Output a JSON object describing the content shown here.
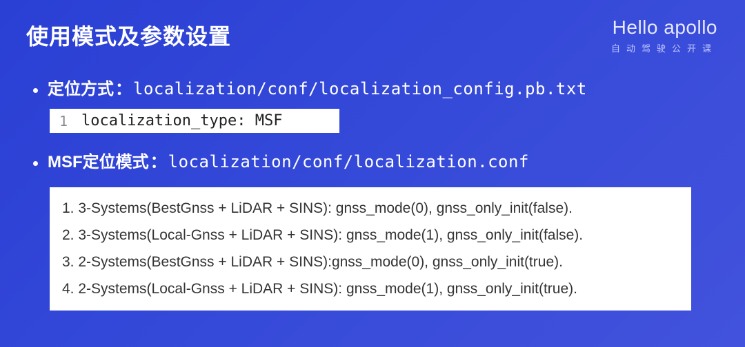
{
  "header": {
    "title": "使用模式及参数设置",
    "brand_main": "Hello apollo",
    "brand_sub": "自动驾驶公开课"
  },
  "section1": {
    "label": "定位方式",
    "colon": "：",
    "path": "localization/conf/localization_config.pb.txt",
    "code_lineno": "1",
    "code_text": "localization_type: MSF"
  },
  "section2": {
    "label": "MSF定位模式",
    "colon": "：",
    "path": "localization/conf/localization.conf"
  },
  "modes": [
    "1. 3-Systems(BestGnss + LiDAR + SINS): gnss_mode(0), gnss_only_init(false).",
    "2. 3-Systems(Local-Gnss + LiDAR + SINS): gnss_mode(1), gnss_only_init(false).",
    "3. 2-Systems(BestGnss + LiDAR + SINS):gnss_mode(0), gnss_only_init(true).",
    "4. 2-Systems(Local-Gnss + LiDAR + SINS): gnss_mode(1), gnss_only_init(true)."
  ]
}
